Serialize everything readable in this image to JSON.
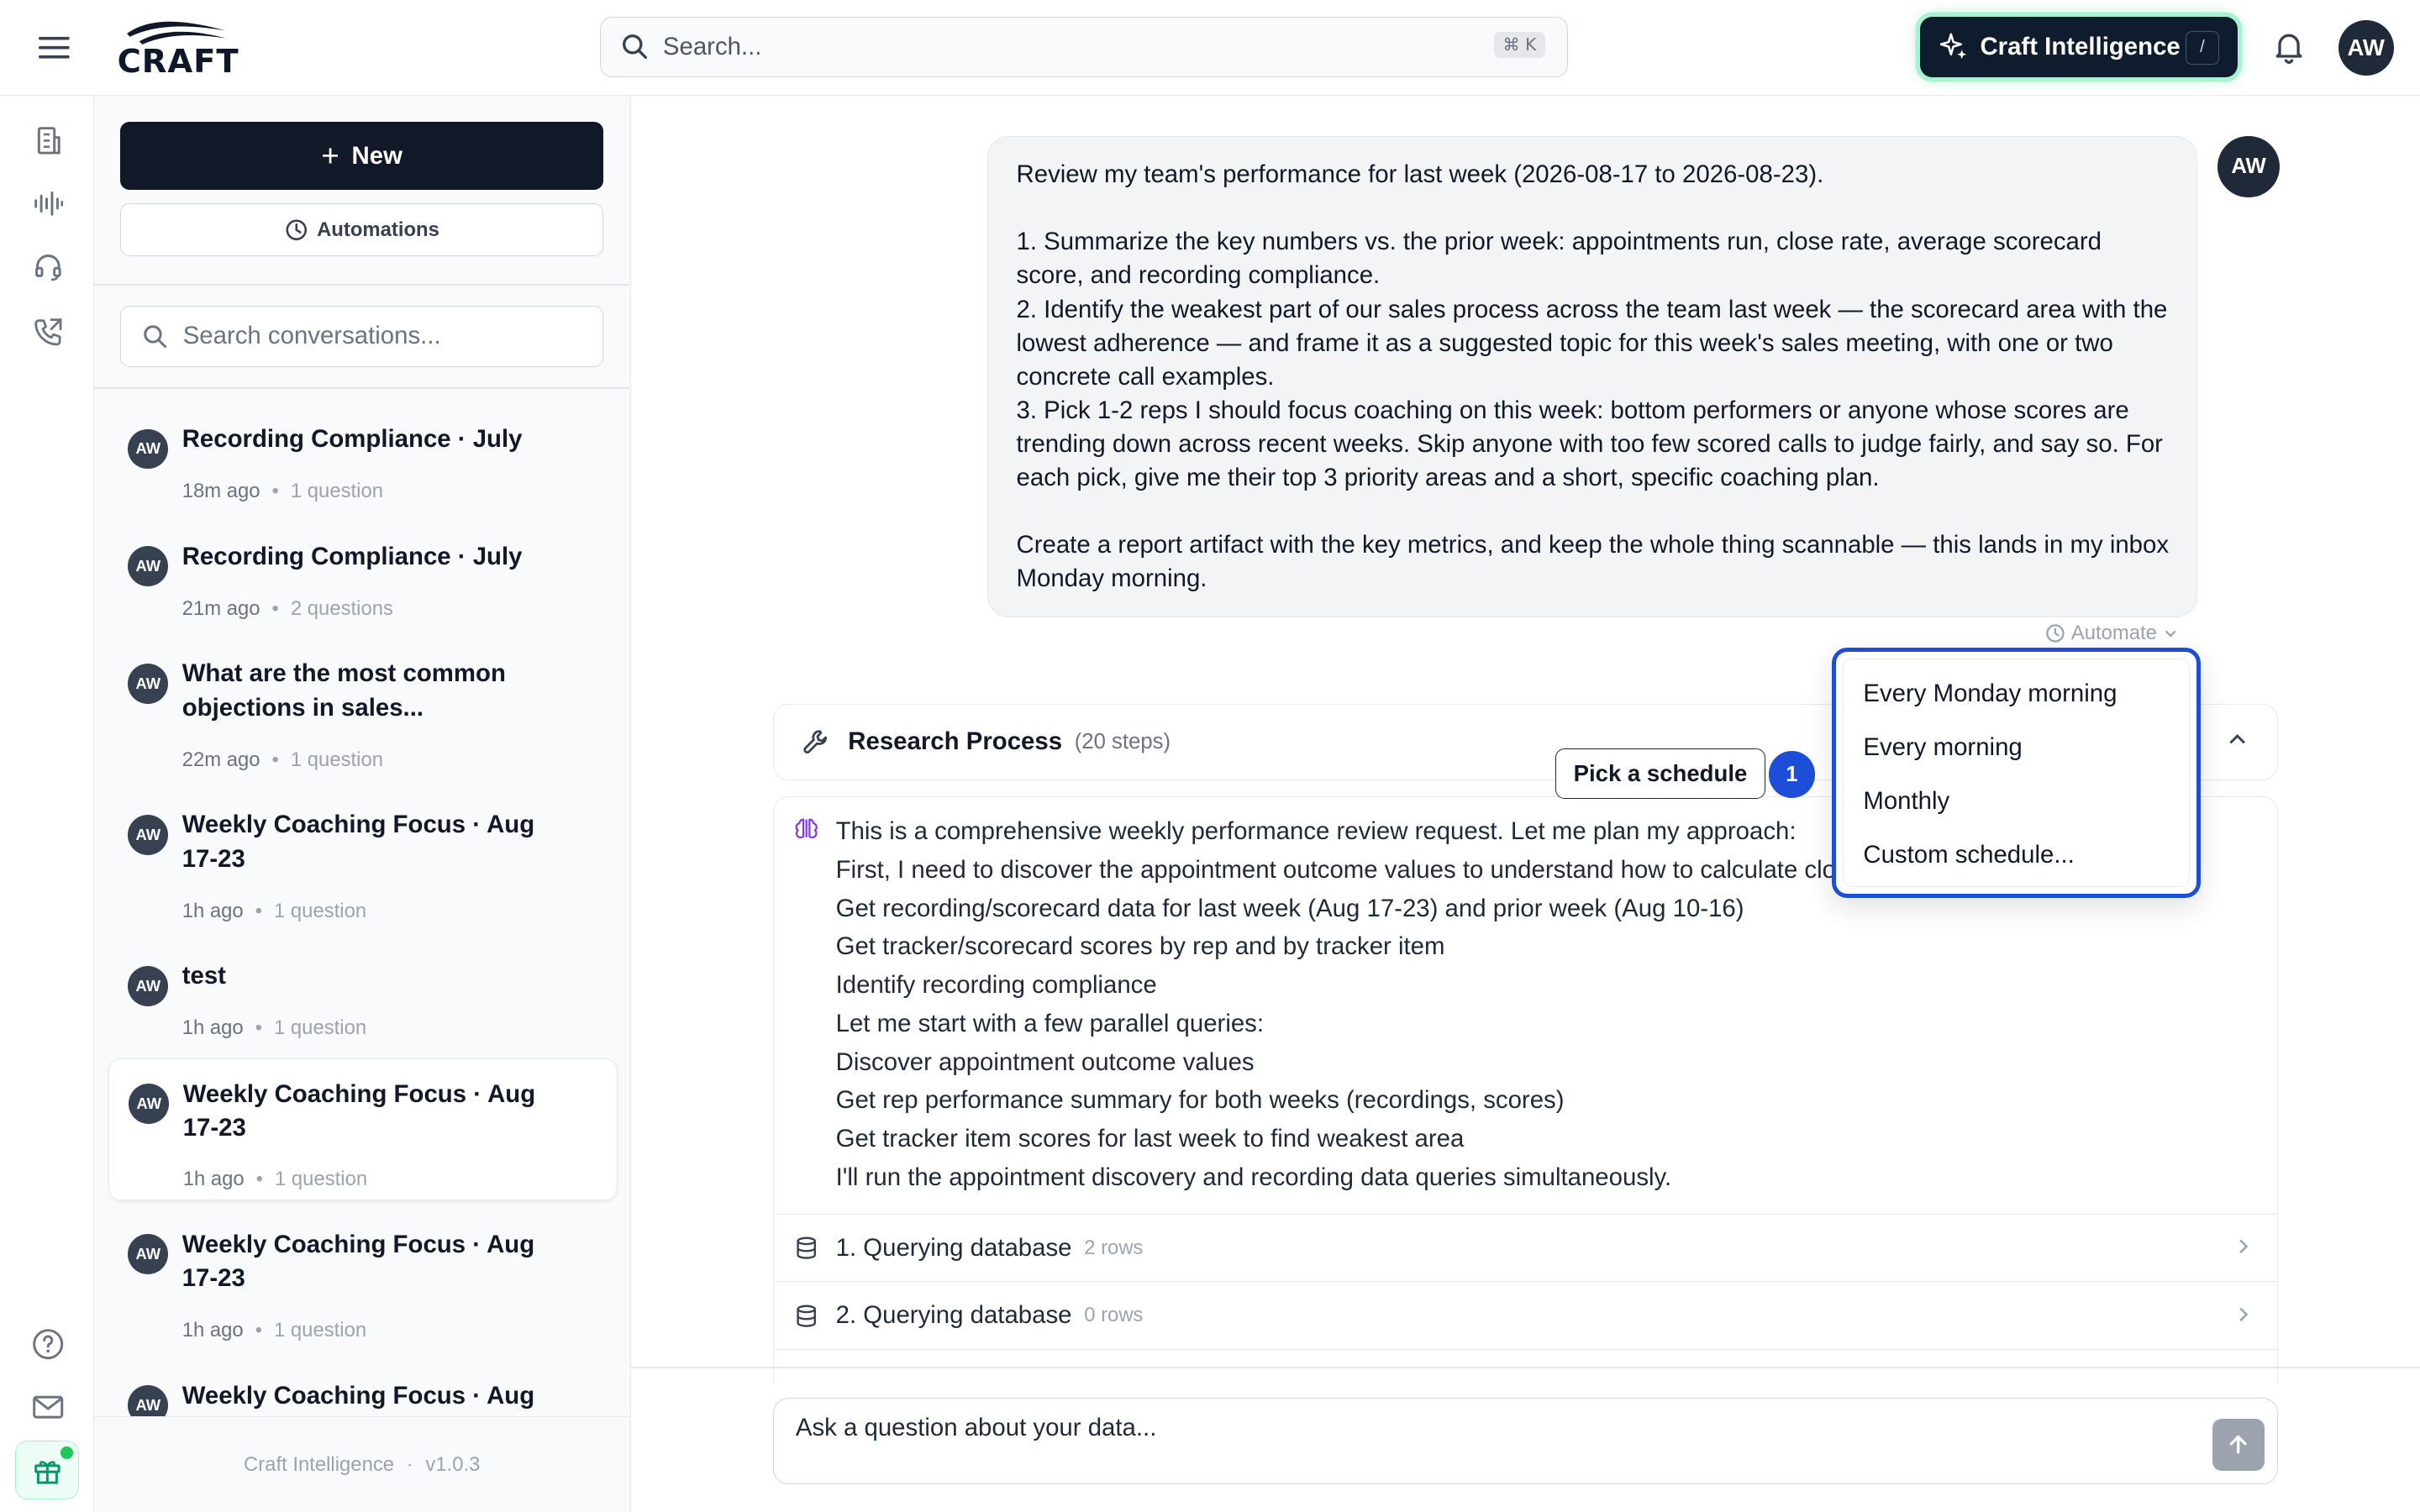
{
  "header": {
    "logo_text": "CRAFT",
    "search_placeholder": "Search...",
    "search_shortcut": "⌘ K",
    "ci_button_label": "Craft Intelligence",
    "ci_shortcut": "/",
    "user_initials": "AW"
  },
  "sidebar": {
    "new_label": "New",
    "automations_label": "Automations",
    "search_placeholder": "Search conversations...",
    "conversations": [
      {
        "title": "Recording Compliance · July",
        "time": "18m ago",
        "questions": "1 question"
      },
      {
        "title": "Recording Compliance · July",
        "time": "21m ago",
        "questions": "2 questions"
      },
      {
        "title": "What are the most common objections in sales...",
        "time": "22m ago",
        "questions": "1 question"
      },
      {
        "title": "Weekly Coaching Focus · Aug 17-23",
        "time": "1h ago",
        "questions": "1 question"
      },
      {
        "title": "test",
        "time": "1h ago",
        "questions": "1 question"
      },
      {
        "title": "Weekly Coaching Focus · Aug 17-23",
        "time": "1h ago",
        "questions": "1 question",
        "active": true
      },
      {
        "title": "Weekly Coaching Focus · Aug 17-23",
        "time": "1h ago",
        "questions": "1 question"
      },
      {
        "title": "Weekly Coaching Focus · Aug",
        "time": "",
        "questions": ""
      }
    ],
    "avatar_initials": "AW",
    "footer_app": "Craft Intelligence",
    "footer_sep": "·",
    "footer_version": "v1.0.3"
  },
  "chat": {
    "user_message": "Review my team's performance for last week (2026-08-17 to 2026-08-23).\n\n1. Summarize the key numbers vs. the prior week: appointments run, close rate, average scorecard score, and recording compliance.\n2. Identify the weakest part of our sales process across the team last week — the scorecard area with the lowest adherence — and frame it as a suggested topic for this week's sales meeting, with one or two concrete call examples.\n3. Pick 1-2 reps I should focus coaching on this week: bottom performers or anyone whose scores are trending down across recent weeks. Skip anyone with too few scored calls to judge fairly, and say so. For each pick, give me their top 3 priority areas and a short, specific coaching plan.\n\nCreate a report artifact with the key metrics, and keep the whole thing scannable — this lands in my inbox Monday morning.",
    "user_initials": "AW",
    "automate_label": "Automate",
    "research_title": "Research Process",
    "research_steps": "(20 steps)",
    "thinking_lines": [
      "This is a comprehensive weekly performance review request. Let me plan my approach:",
      "First, I need to discover the appointment outcome values to understand how to calculate close rate",
      "Get recording/scorecard data for last week (Aug 17-23) and prior week (Aug 10-16)",
      "Get tracker/scorecard scores by rep and by tracker item",
      "Identify recording compliance",
      "Let me start with a few parallel queries:",
      "Discover appointment outcome values",
      "Get rep performance summary for both weeks (recordings, scores)",
      "Get tracker item scores for last week to find weakest area",
      "I'll run the appointment discovery and recording data queries simultaneously."
    ],
    "steps": [
      {
        "label": "1. Querying database",
        "rows": "2 rows"
      },
      {
        "label": "2. Querying database",
        "rows": "0 rows"
      }
    ],
    "input_placeholder": "Ask a question about your data..."
  },
  "overlay": {
    "tip_label": "Pick a schedule",
    "tip_number": "1",
    "schedule_options": [
      "Every Monday morning",
      "Every morning",
      "Monthly",
      "Custom schedule..."
    ]
  },
  "colors": {
    "primary_dark": "#111827",
    "accent_blue": "#1d4ed8",
    "ci_glow": "#a7f3d0"
  }
}
